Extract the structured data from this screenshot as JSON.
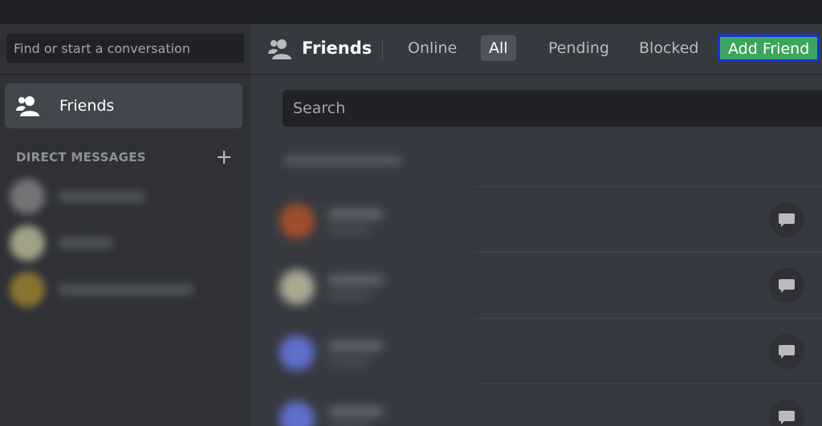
{
  "sidebar": {
    "search_placeholder": "Find or start a conversation",
    "friends_label": "Friends",
    "dm_title": "DIRECT MESSAGES",
    "dm_add": "+"
  },
  "header": {
    "title": "Friends",
    "tabs": {
      "online": "Online",
      "all": "All",
      "pending": "Pending",
      "blocked": "Blocked"
    },
    "add_friend": "Add Friend"
  },
  "main": {
    "search_placeholder": "Search"
  },
  "colors": {
    "accent_green": "#3ba55c",
    "highlight_outline": "#1a2fe6",
    "avatar_1": "#b8542a",
    "avatar_2": "#c8c4a8",
    "avatar_3": "#6b7cf0",
    "avatar_4": "#6b7cf0",
    "dm_avatar_1": "#8a8a8a",
    "dm_avatar_2": "#c8c8a0",
    "dm_avatar_3": "#a88a30"
  }
}
